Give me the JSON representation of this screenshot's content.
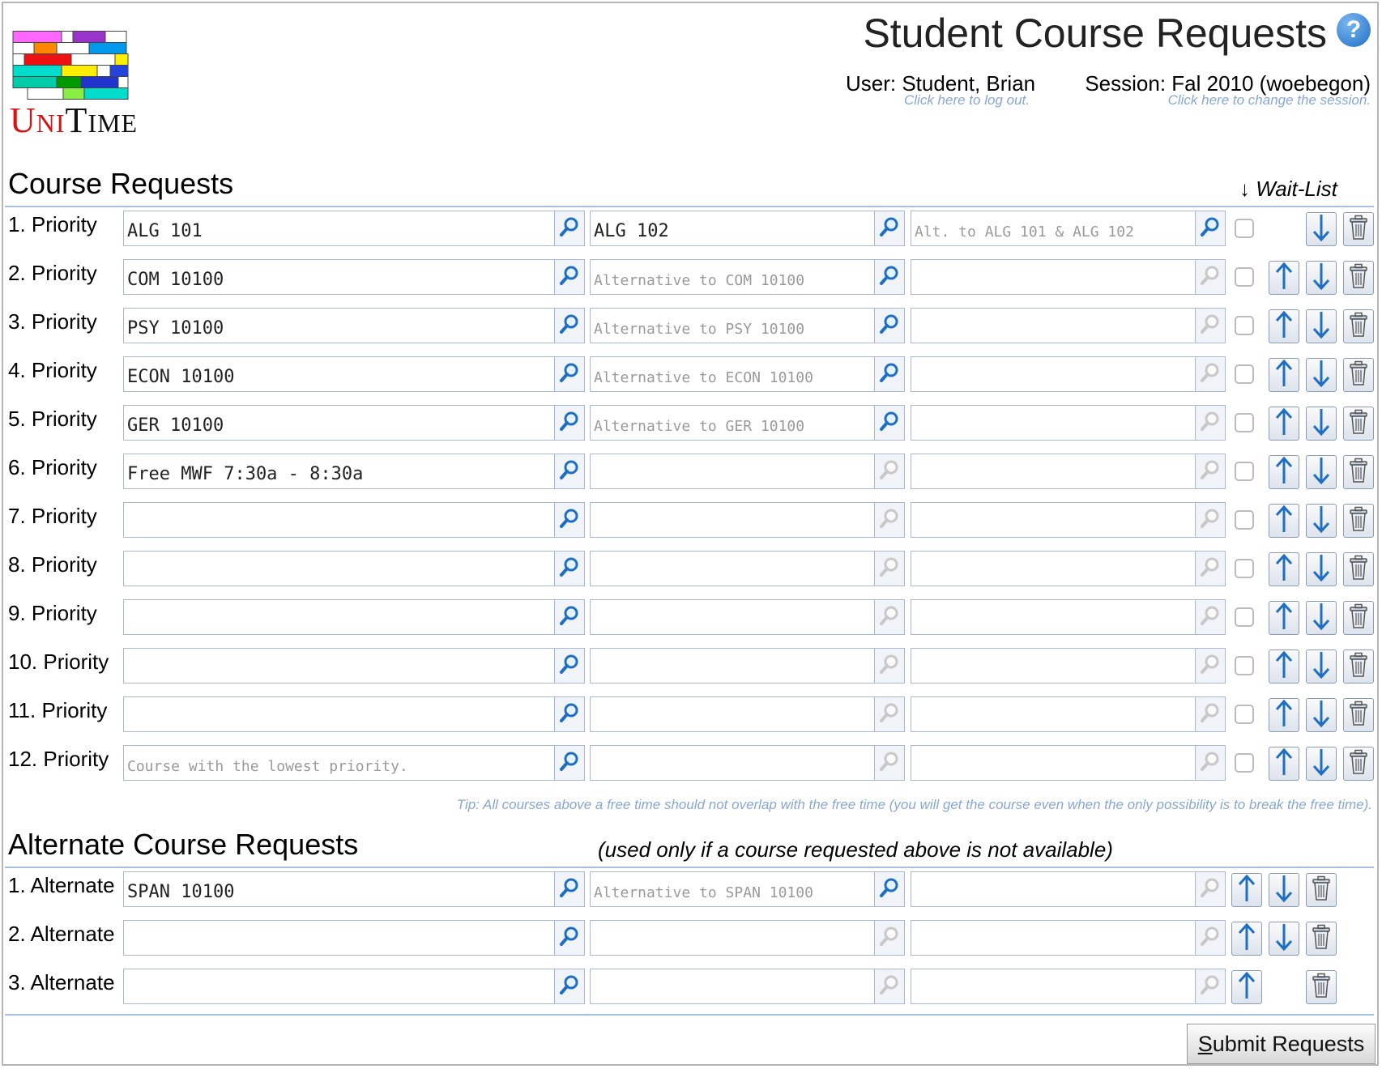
{
  "header": {
    "logo_text": "UniTime",
    "title": "Student Course Requests",
    "user_label": "User: Student, Brian",
    "logout_hint": "Click here to log out.",
    "session_label": "Session: Fal 2010 (woebegon)",
    "session_hint": "Click here to change the session."
  },
  "course_requests": {
    "title": "Course Requests",
    "waitlist_header": "↓ Wait-List",
    "rows": [
      {
        "label": "1. Priority",
        "course": "ALG 101",
        "course_placeholder": "",
        "alt1": "ALG 102",
        "alt1_placeholder": "",
        "alt2": "",
        "alt2_placeholder": "Alt. to ALG 101 & ALG 102"
      },
      {
        "label": "2. Priority",
        "course": "COM 10100",
        "course_placeholder": "",
        "alt1": "",
        "alt1_placeholder": "Alternative to COM 10100",
        "alt2": "",
        "alt2_placeholder": ""
      },
      {
        "label": "3. Priority",
        "course": "PSY 10100",
        "course_placeholder": "",
        "alt1": "",
        "alt1_placeholder": "Alternative to PSY 10100",
        "alt2": "",
        "alt2_placeholder": ""
      },
      {
        "label": "4. Priority",
        "course": "ECON 10100",
        "course_placeholder": "",
        "alt1": "",
        "alt1_placeholder": "Alternative to ECON 10100",
        "alt2": "",
        "alt2_placeholder": ""
      },
      {
        "label": "5. Priority",
        "course": "GER 10100",
        "course_placeholder": "",
        "alt1": "",
        "alt1_placeholder": "Alternative to GER 10100",
        "alt2": "",
        "alt2_placeholder": ""
      },
      {
        "label": "6. Priority",
        "course": "Free MWF 7:30a - 8:30a",
        "course_placeholder": "",
        "alt1": "",
        "alt1_placeholder": "",
        "alt2": "",
        "alt2_placeholder": ""
      },
      {
        "label": "7. Priority",
        "course": "",
        "course_placeholder": "",
        "alt1": "",
        "alt1_placeholder": "",
        "alt2": "",
        "alt2_placeholder": ""
      },
      {
        "label": "8. Priority",
        "course": "",
        "course_placeholder": "",
        "alt1": "",
        "alt1_placeholder": "",
        "alt2": "",
        "alt2_placeholder": ""
      },
      {
        "label": "9. Priority",
        "course": "",
        "course_placeholder": "",
        "alt1": "",
        "alt1_placeholder": "",
        "alt2": "",
        "alt2_placeholder": ""
      },
      {
        "label": "10. Priority",
        "course": "",
        "course_placeholder": "",
        "alt1": "",
        "alt1_placeholder": "",
        "alt2": "",
        "alt2_placeholder": ""
      },
      {
        "label": "11. Priority",
        "course": "",
        "course_placeholder": "",
        "alt1": "",
        "alt1_placeholder": "",
        "alt2": "",
        "alt2_placeholder": ""
      },
      {
        "label": "12. Priority",
        "course": "",
        "course_placeholder": "Course with the lowest priority.",
        "alt1": "",
        "alt1_placeholder": "",
        "alt2": "",
        "alt2_placeholder": ""
      }
    ],
    "tip": "Tip: All courses above a free time should not overlap with the free time (you will get the course even when the only possibility is to break the free time)."
  },
  "alternate_requests": {
    "title": "Alternate Course Requests",
    "note": "(used only if a course requested above is not available)",
    "rows": [
      {
        "label": "1. Alternate",
        "course": "SPAN 10100",
        "course_placeholder": "",
        "alt1": "",
        "alt1_placeholder": "Alternative to SPAN 10100",
        "alt2": "",
        "alt2_placeholder": ""
      },
      {
        "label": "2. Alternate",
        "course": "",
        "course_placeholder": "",
        "alt1": "",
        "alt1_placeholder": "",
        "alt2": "",
        "alt2_placeholder": ""
      },
      {
        "label": "3. Alternate",
        "course": "",
        "course_placeholder": "",
        "alt1": "",
        "alt1_placeholder": "",
        "alt2": "",
        "alt2_placeholder": ""
      }
    ]
  },
  "submit": {
    "label_first": "S",
    "label_rest": "ubmit Requests"
  },
  "colors": {
    "accent": "#1e6fc4",
    "link": "#87a7d4",
    "border": "#a9b8cf"
  },
  "icons": {
    "search": "search-icon",
    "up": "up-arrow-icon",
    "down": "down-arrow-icon",
    "delete": "trash-icon",
    "help": "help-icon"
  }
}
